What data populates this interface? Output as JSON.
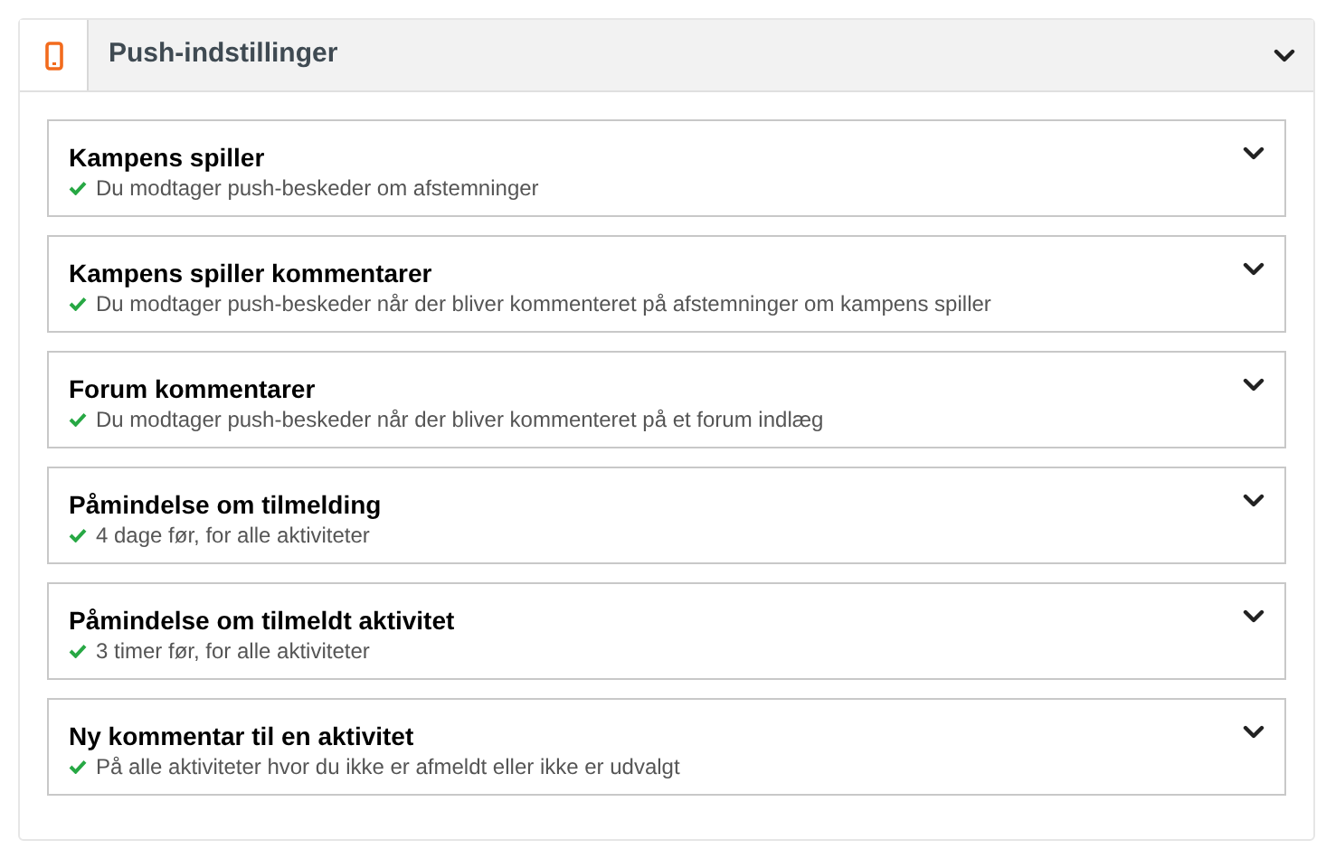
{
  "panel": {
    "title": "Push-indstillinger"
  },
  "settings": [
    {
      "title": "Kampens spiller",
      "status": "Du modtager push-beskeder om afstemninger",
      "enabled": true
    },
    {
      "title": "Kampens spiller kommentarer",
      "status": "Du modtager push-beskeder når der bliver kommenteret på afstemninger om kampens spiller",
      "enabled": true
    },
    {
      "title": "Forum kommentarer",
      "status": "Du modtager push-beskeder når der bliver kommenteret på et forum indlæg",
      "enabled": true
    },
    {
      "title": "Påmindelse om tilmelding",
      "status": "4 dage før, for alle aktiviteter",
      "enabled": true
    },
    {
      "title": "Påmindelse om tilmeldt aktivitet",
      "status": "3 timer før, for alle aktiviteter",
      "enabled": true
    },
    {
      "title": "Ny kommentar til en aktivitet",
      "status": "På alle aktiviteter hvor du ikke er afmeldt eller ikke er udvalgt",
      "enabled": true
    }
  ]
}
